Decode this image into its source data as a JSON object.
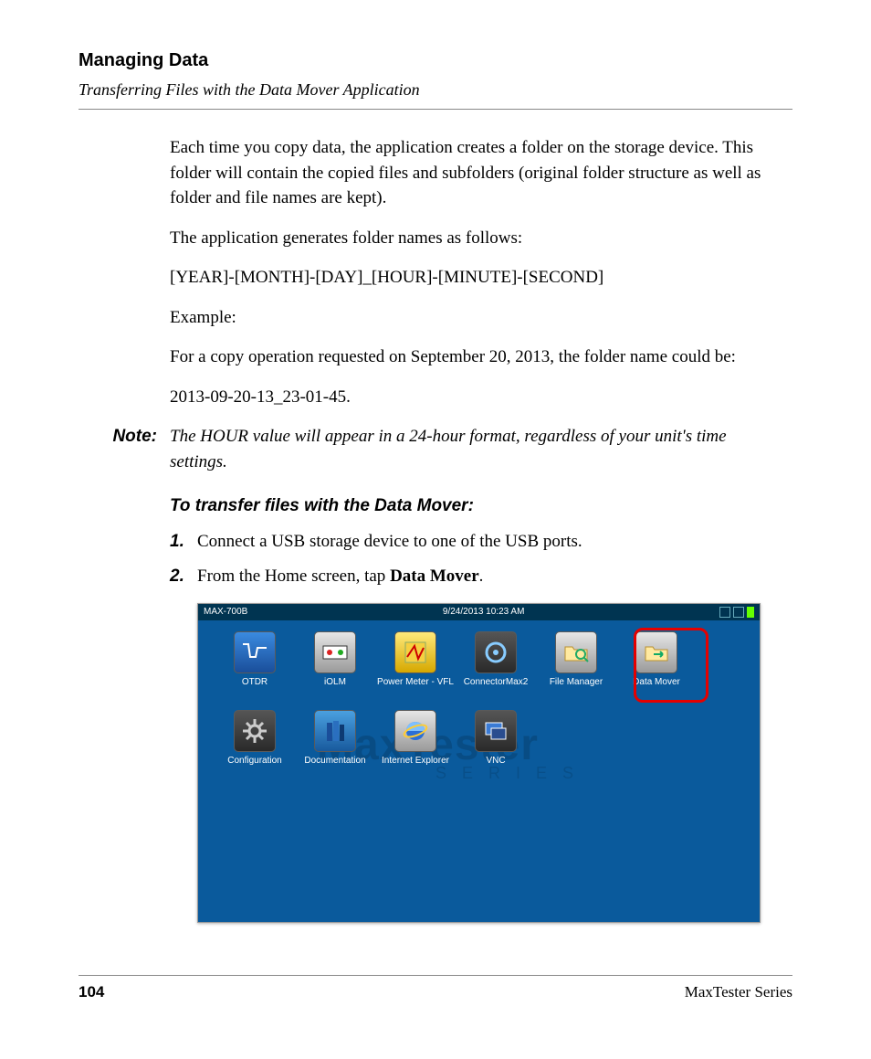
{
  "header": {
    "title": "Managing Data",
    "subtitle": "Transferring Files with the Data Mover Application"
  },
  "paragraphs": {
    "p1": "Each time you copy data, the application creates a folder on the storage device. This folder will contain the copied files and subfolders (original folder structure as well as folder and file names are kept).",
    "p2": "The application generates folder names as follows:",
    "p3": "[YEAR]-[MONTH]-[DAY]_[HOUR]-[MINUTE]-[SECOND]",
    "p4": "Example:",
    "p5": "For a copy operation requested on September 20, 2013, the folder name could be:",
    "p6": "2013-09-20-13_23-01-45."
  },
  "note": {
    "label": "Note:",
    "text": "The HOUR value will appear in a 24-hour format, regardless of your unit's time settings."
  },
  "instructions": {
    "title": "To transfer files with the Data Mover:",
    "steps": [
      {
        "num": "1.",
        "text": "Connect a USB storage device to one of the USB ports."
      },
      {
        "num": "2.",
        "prefix": "From the Home screen, tap ",
        "bold": "Data Mover",
        "suffix": "."
      }
    ]
  },
  "screenshot": {
    "statusbar": {
      "device": "MAX-700B",
      "datetime": "9/24/2013 10:23 AM"
    },
    "watermark": "MaxTester",
    "watermark_sub": "S E R I E S",
    "apps_row1": [
      {
        "label": "OTDR",
        "icon": "otdr"
      },
      {
        "label": "iOLM",
        "icon": "iolm"
      },
      {
        "label": "Power Meter - VFL",
        "icon": "pmvfl"
      },
      {
        "label": "ConnectorMax2",
        "icon": "cmax"
      },
      {
        "label": "File Manager",
        "icon": "fileman"
      },
      {
        "label": "Data Mover",
        "icon": "datamover",
        "highlight": true
      }
    ],
    "apps_row2": [
      {
        "label": "Configuration",
        "icon": "config"
      },
      {
        "label": "Documentation",
        "icon": "docs"
      },
      {
        "label": "Internet Explorer",
        "icon": "ie"
      },
      {
        "label": "VNC",
        "icon": "vnc"
      }
    ]
  },
  "footer": {
    "page": "104",
    "series": "MaxTester Series"
  }
}
